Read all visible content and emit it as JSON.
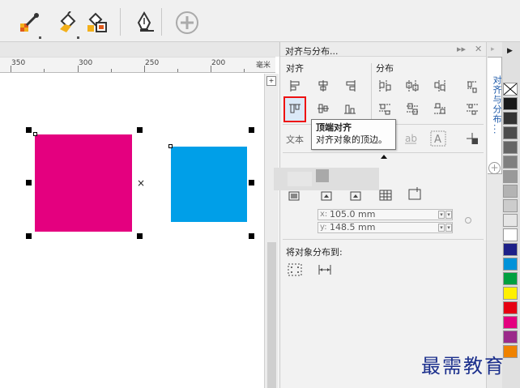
{
  "ruler": {
    "labels": [
      "350",
      "300",
      "250",
      "200",
      "150"
    ],
    "unit": "毫米"
  },
  "docker": {
    "title": "对齐与分布...",
    "align_section": "对齐",
    "distribute_section": "分布",
    "text_label": "文本",
    "distribute_to_label": "将对象分布到:",
    "x_label": "x:",
    "x_value": "105.0 mm",
    "y_label": "y:",
    "y_value": "148.5 mm"
  },
  "tooltip": {
    "title": "顶端对齐",
    "description": "对齐对象的顶边。"
  },
  "side_tab": {
    "label": "对齐与分布..."
  },
  "shapes": {
    "magenta_color": "#e4007f",
    "blue_color": "#009fe8"
  },
  "palette": [
    "#ffffff",
    "#1a1a1a",
    "#333333",
    "#4d4d4d",
    "#666666",
    "#808080",
    "#999999",
    "#b3b3b3",
    "#cccccc",
    "#e6e6e6",
    "#ffffff",
    "#1d2088",
    "#0092d9",
    "#00a040",
    "#fff000",
    "#e60012",
    "#e4007f",
    "#9b2a8a",
    "#ef8200"
  ],
  "watermark": "最需教育"
}
